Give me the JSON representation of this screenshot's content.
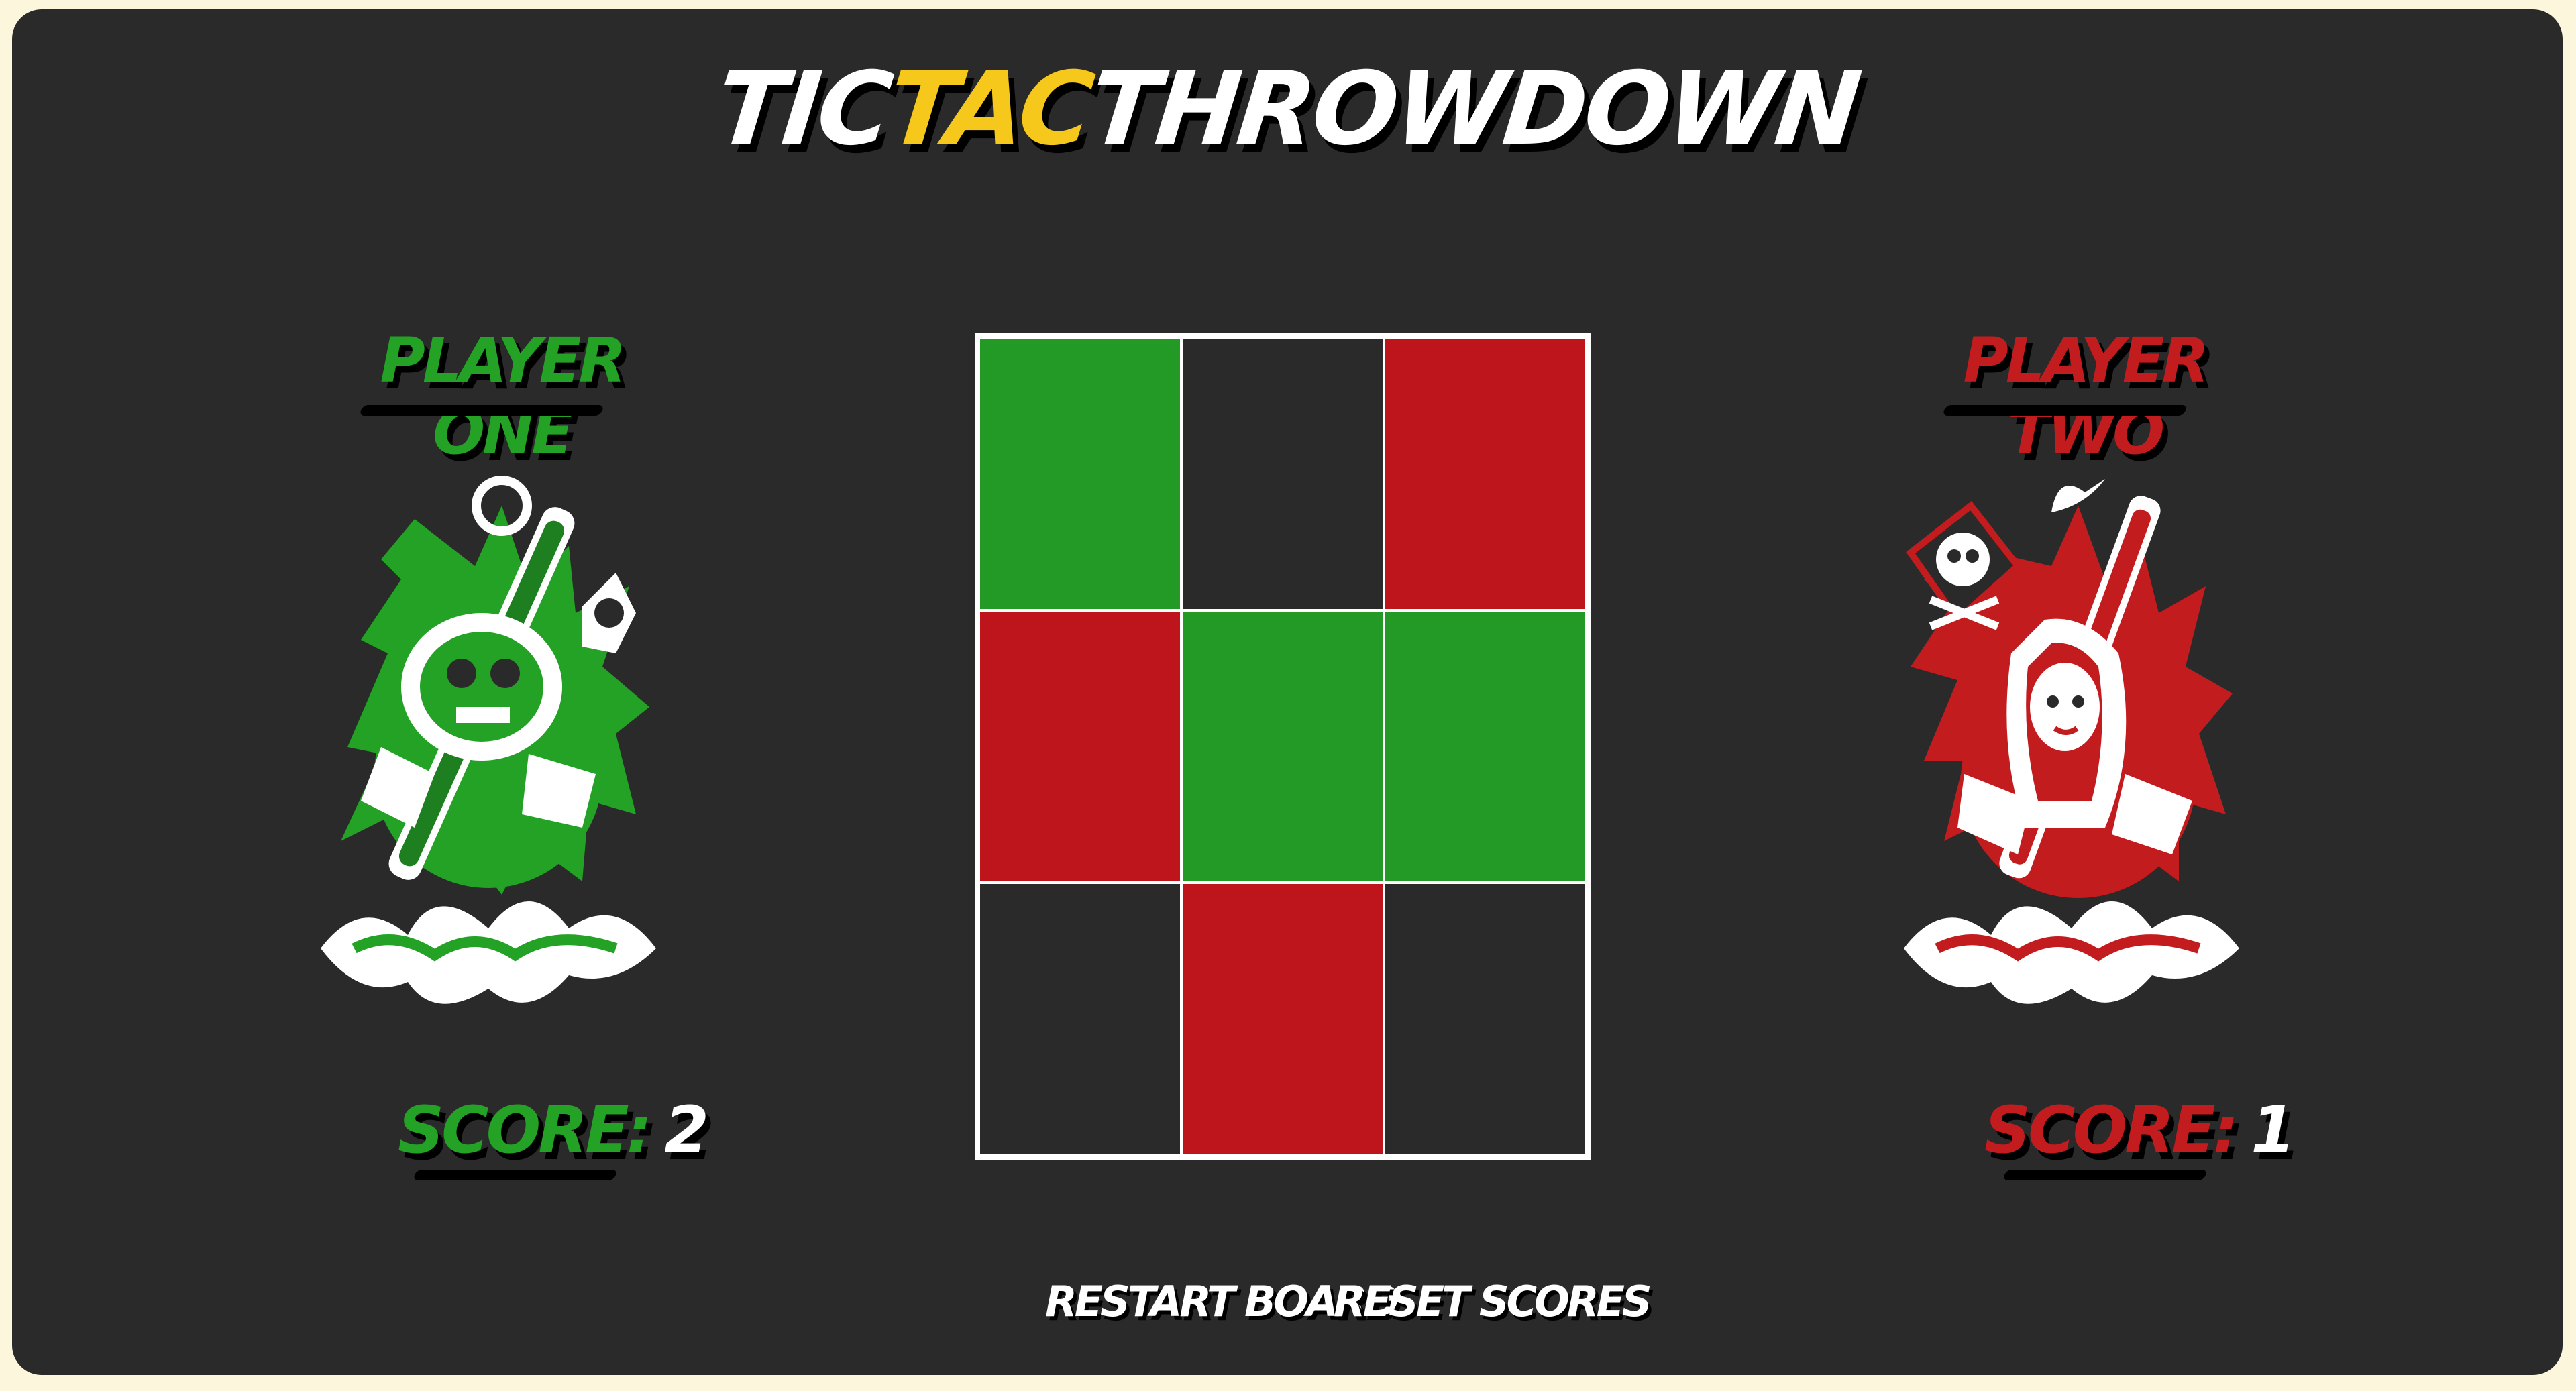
{
  "game": {
    "title_left": "TIC",
    "title_accent": "TAC",
    "title_right": "THROWDOWN"
  },
  "colors": {
    "background": "#2a2a2a",
    "outer": "#fbf6dc",
    "player_one": "#23a226",
    "player_two": "#c31c1f",
    "accent": "#f6c81b"
  },
  "player_one": {
    "label": "PLAYER ONE",
    "score_label": "SCORE:",
    "score": "2",
    "avatar": "warrior-skull-illustration-green"
  },
  "player_two": {
    "label": "PLAYER TWO",
    "score_label": "SCORE:",
    "score": "1",
    "avatar": "warrior-woman-illustration-red"
  },
  "board": {
    "cells": [
      "p1",
      "empty",
      "p2",
      "p2",
      "p1",
      "p1",
      "empty",
      "p2",
      "empty"
    ]
  },
  "controls": {
    "restart_label": "RESTART BOARD",
    "reset_label": "RESET SCORES"
  }
}
